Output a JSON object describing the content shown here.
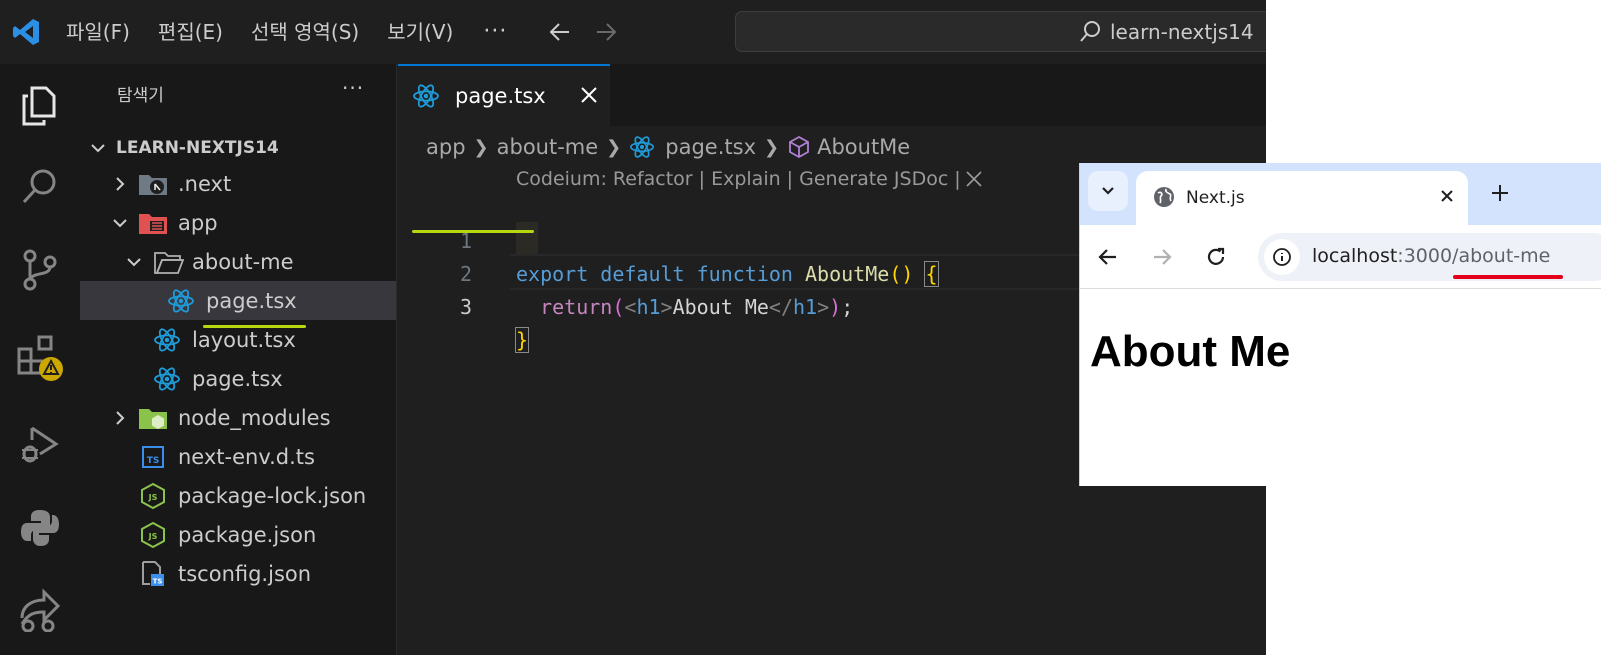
{
  "vscode": {
    "menu": [
      "파일(F)",
      "편집(E)",
      "선택 영역(S)",
      "보기(V)"
    ],
    "menu_more": "···",
    "command_center": "learn-nextjs14",
    "explorer": {
      "title": "탐색기",
      "more": "···",
      "root": "LEARN-NEXTJS14",
      "items": [
        ".next",
        "app",
        "about-me",
        "page.tsx",
        "layout.tsx",
        "page.tsx",
        "node_modules",
        "next-env.d.ts",
        "package-lock.json",
        "package.json",
        "tsconfig.json"
      ]
    },
    "tab": {
      "label": "page.tsx"
    },
    "breadcrumb": [
      "app",
      "about-me",
      "page.tsx",
      "AboutMe"
    ],
    "codelens": "Codeium: Refactor | Explain | Generate JSDoc |",
    "code": {
      "line_numbers": [
        "1",
        "2",
        "3"
      ],
      "line1": {
        "kw1": "export",
        "kw2": "default",
        "kw3": "function",
        "name": "AboutMe",
        "parens": "()",
        "brace": "{"
      },
      "line2": {
        "kw": "return",
        "open": "(",
        "lt": "<",
        "tag1": "h1",
        "gt": ">",
        "text": "About Me",
        "lt2": "</",
        "tag2": "h1",
        "gt2": ">",
        "close": ")",
        "semi": ";"
      },
      "line3": {
        "brace": "}"
      }
    },
    "colors": {
      "accent": "#0078d4",
      "react_icon": "#1e9bd8",
      "folder_blue": "#5f9ad3",
      "node_green": "#8bc34a",
      "warning": "#cca700"
    }
  },
  "browser": {
    "tab_title": "Next.js",
    "url_host": "localhost",
    "url_rest": ":3000/about-me",
    "heading": "About Me"
  },
  "annotation_colors": {
    "green": "#b5d80e",
    "red": "#e2001a"
  }
}
